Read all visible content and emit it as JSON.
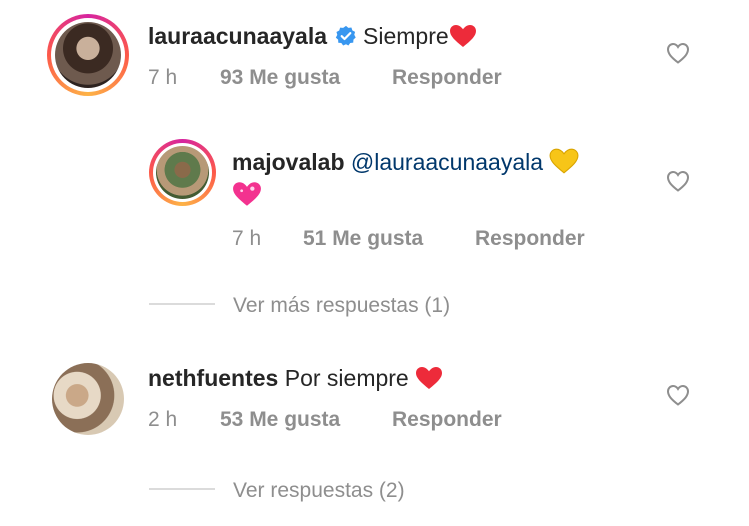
{
  "comments": [
    {
      "username": "lauraacunaayala",
      "verified": true,
      "text": "Siempre",
      "emoji": "red-heart",
      "time": "7 h",
      "likes": "93 Me gusta",
      "reply": "Responder",
      "replies": [
        {
          "username": "majovalab",
          "mention": "@lauraacunaayala",
          "emoji": [
            "yellow-heart",
            "sparkling-heart"
          ],
          "time": "7 h",
          "likes": "51 Me gusta",
          "reply": "Responder"
        }
      ],
      "more_replies": "Ver más respuestas (1)"
    },
    {
      "username": "nethfuentes",
      "text": "Por siempre",
      "emoji": "red-heart",
      "time": "2 h",
      "likes": "53 Me gusta",
      "reply": "Responder",
      "more_replies": "Ver respuestas (2)"
    }
  ],
  "colors": {
    "text": "#262626",
    "meta": "#8e8e8e",
    "mention": "#00376b",
    "verified": "#3897f0",
    "heart_red": "#ed4956",
    "divider": "#dbdbdb"
  }
}
